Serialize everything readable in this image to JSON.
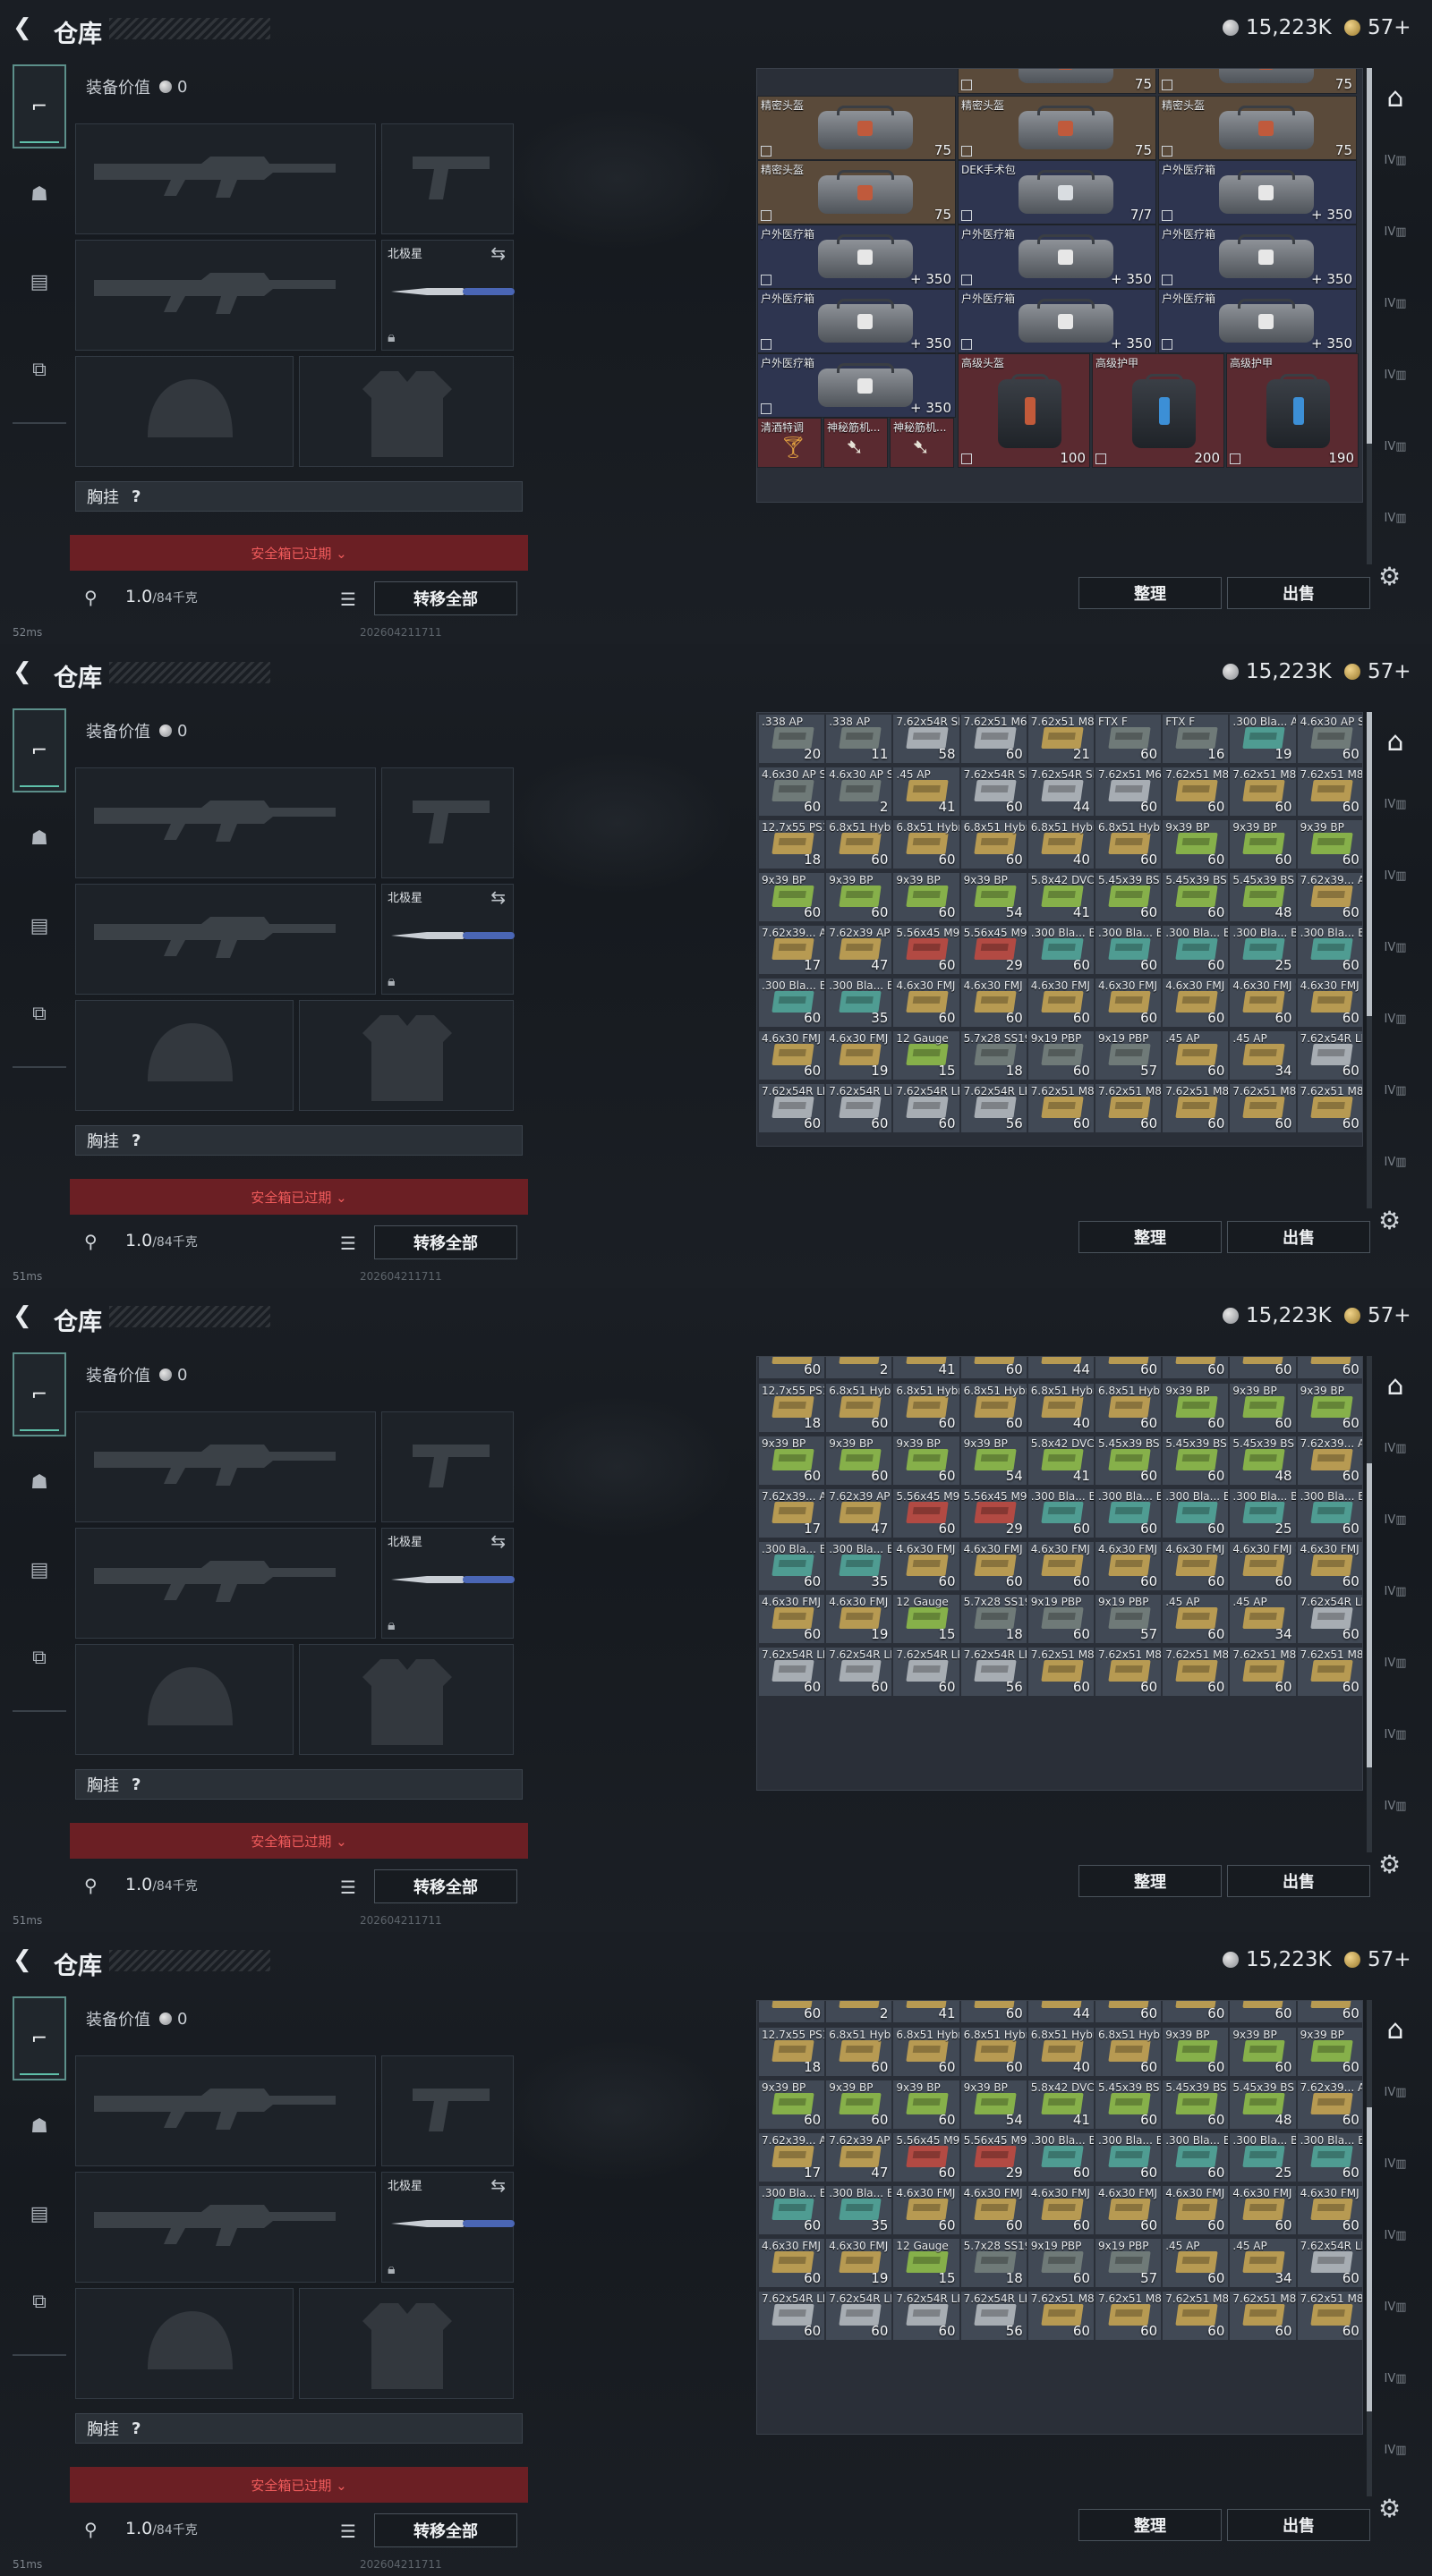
{
  "header": {
    "title": "仓库",
    "currency_value": "15,223K",
    "points_value": "57+"
  },
  "equipment": {
    "value_label": "装备价值",
    "value": "0",
    "knife_name": "北极星",
    "chest_label": "胸挂",
    "chest_hint": "?",
    "secure_box": "安全箱已过期 ⌄",
    "weight_value": "1.0",
    "weight_max": "/84千克",
    "transfer_all": "转移全部"
  },
  "actions": {
    "sort": "整理",
    "sell": "出售"
  },
  "status": [
    {
      "ping": "52ms",
      "build": "202604211711"
    },
    {
      "ping": "51ms",
      "build": "202604211711"
    },
    {
      "ping": "51ms",
      "build": "202604211711"
    },
    {
      "ping": "51ms",
      "build": "202604211711"
    }
  ],
  "inventory_page1": {
    "gear_row0": [
      {
        "quantity": "75"
      },
      {
        "quantity": "75"
      }
    ],
    "gear": [
      {
        "name": "精密头盔",
        "quantity": "75"
      },
      {
        "name": "精密头盔",
        "quantity": "75"
      },
      {
        "name": "精密头盔",
        "quantity": "75"
      },
      {
        "name": "精密头盔",
        "quantity": "75"
      },
      {
        "name": "DEK手术包",
        "quantity": "7/7"
      },
      {
        "name": "户外医疗箱",
        "quantity": "+ 350"
      },
      {
        "name": "户外医疗箱",
        "quantity": "+ 350"
      },
      {
        "name": "户外医疗箱",
        "quantity": "+ 350"
      },
      {
        "name": "户外医疗箱",
        "quantity": "+ 350"
      },
      {
        "name": "户外医疗箱",
        "quantity": "+ 350"
      },
      {
        "name": "户外医疗箱",
        "quantity": "+ 350"
      },
      {
        "name": "户外医疗箱",
        "quantity": "+ 350"
      },
      {
        "name": "户外医疗箱",
        "quantity": "+ 350"
      },
      {
        "name": "高级头盔",
        "quantity": "100"
      },
      {
        "name": "高级护甲",
        "quantity": "200"
      },
      {
        "name": "高级护甲",
        "quantity": "190"
      }
    ],
    "small": [
      {
        "name": "清酒特调"
      },
      {
        "name": "神秘筋机..."
      },
      {
        "name": "神秘筋机..."
      }
    ]
  },
  "ammo_rows_full": [
    [
      {
        "n": ".338 AP",
        "q": "20"
      },
      {
        "n": ".338 AP",
        "q": "11"
      },
      {
        "n": "7.62x54R SNB",
        "q": "58"
      },
      {
        "n": "7.62x51 M62",
        "q": "60"
      },
      {
        "n": "7.62x51 M80",
        "q": "21"
      },
      {
        "n": "FTX F",
        "q": "60"
      },
      {
        "n": "FTX F",
        "q": "16"
      },
      {
        "n": ".300 Bla... AP",
        "q": "19"
      },
      {
        "n": "4.6x30 AP SX",
        "q": "60"
      }
    ],
    [
      {
        "n": "4.6x30 AP SX",
        "q": "60"
      },
      {
        "n": "4.6x30 AP SX",
        "q": "2"
      },
      {
        "n": ".45 AP",
        "q": "41"
      },
      {
        "n": "7.62x54R SNB",
        "q": "60"
      },
      {
        "n": "7.62x54R SNB",
        "q": "44"
      },
      {
        "n": "7.62x51 M62",
        "q": "60"
      },
      {
        "n": "7.62x51 M80",
        "q": "60"
      },
      {
        "n": "7.62x51 M80",
        "q": "60"
      },
      {
        "n": "7.62x51 M80",
        "q": "60"
      }
    ],
    [
      {
        "n": "12.7x55 PS12B",
        "q": "18"
      },
      {
        "n": "6.8x51 Hybrid",
        "q": "60"
      },
      {
        "n": "6.8x51 Hybrid",
        "q": "60"
      },
      {
        "n": "6.8x51 Hybrid",
        "q": "60"
      },
      {
        "n": "6.8x51 Hybrid",
        "q": "40"
      },
      {
        "n": "6.8x51 Hybrid",
        "q": "60"
      },
      {
        "n": "9x39 BP",
        "q": "60"
      },
      {
        "n": "9x39 BP",
        "q": "60"
      },
      {
        "n": "9x39 BP",
        "q": "60"
      }
    ],
    [
      {
        "n": "9x39 BP",
        "q": "60"
      },
      {
        "n": "9x39 BP",
        "q": "60"
      },
      {
        "n": "9x39 BP",
        "q": "60"
      },
      {
        "n": "9x39 BP",
        "q": "54"
      },
      {
        "n": "5.8x42 DVC12",
        "q": "41"
      },
      {
        "n": "5.45x39 BS",
        "q": "60"
      },
      {
        "n": "5.45x39 BS",
        "q": "60"
      },
      {
        "n": "5.45x39 BS",
        "q": "48"
      },
      {
        "n": "7.62x39... AP",
        "q": "60"
      }
    ],
    [
      {
        "n": "7.62x39... AP",
        "q": "17"
      },
      {
        "n": "7.62x39 AP",
        "q": "47"
      },
      {
        "n": "5.56x45 M995",
        "q": "60"
      },
      {
        "n": "5.56x45 M995",
        "q": "29"
      },
      {
        "n": ".300 Bla... BPZ",
        "q": "60"
      },
      {
        "n": ".300 Bla... BPZ",
        "q": "60"
      },
      {
        "n": ".300 Bla... BPZ",
        "q": "60"
      },
      {
        "n": ".300 Bla... BPZ",
        "q": "25"
      },
      {
        "n": ".300 Bla... BPZ",
        "q": "60"
      }
    ],
    [
      {
        "n": ".300 Bla... BPZ",
        "q": "60"
      },
      {
        "n": ".300 Bla... BPZ",
        "q": "35"
      },
      {
        "n": "4.6x30 FMJ SX",
        "q": "60"
      },
      {
        "n": "4.6x30 FMJ SX",
        "q": "60"
      },
      {
        "n": "4.6x30 FMJ SX",
        "q": "60"
      },
      {
        "n": "4.6x30 FMJ SX",
        "q": "60"
      },
      {
        "n": "4.6x30 FMJ SX",
        "q": "60"
      },
      {
        "n": "4.6x30 FMJ SX",
        "q": "60"
      },
      {
        "n": "4.6x30 FMJ SX",
        "q": "60"
      }
    ],
    [
      {
        "n": "4.6x30 FMJ SX",
        "q": "60"
      },
      {
        "n": "4.6x30 FMJ SX",
        "q": "19"
      },
      {
        "n": "12 Gauge",
        "q": "15"
      },
      {
        "n": "5.7x28 SS190",
        "q": "18"
      },
      {
        "n": "9x19 PBP",
        "q": "60"
      },
      {
        "n": "9x19 PBP",
        "q": "57"
      },
      {
        "n": ".45 AP",
        "q": "60"
      },
      {
        "n": ".45 AP",
        "q": "34"
      },
      {
        "n": "7.62x54R LPS",
        "q": "60"
      }
    ],
    [
      {
        "n": "7.62x54R LPS",
        "q": "60"
      },
      {
        "n": "7.62x54R LPS",
        "q": "60"
      },
      {
        "n": "7.62x54R LPS",
        "q": "60"
      },
      {
        "n": "7.62x54R LPS",
        "q": "56"
      },
      {
        "n": "7.62x51 M80",
        "q": "60"
      },
      {
        "n": "7.62x51 M80",
        "q": "60"
      },
      {
        "n": "7.62x51 M80",
        "q": "60"
      },
      {
        "n": "7.62x51 M80",
        "q": "60"
      },
      {
        "n": "7.62x51 M80",
        "q": "60"
      }
    ]
  ],
  "ammo_scrolled_top": [
    {
      "q": "60"
    },
    {
      "q": "2"
    },
    {
      "q": "41"
    },
    {
      "q": "60"
    },
    {
      "q": "44"
    },
    {
      "q": "60"
    },
    {
      "q": "60"
    },
    {
      "q": "60"
    },
    {
      "q": "60"
    }
  ],
  "colors": {
    "accent": "#5fc0aa",
    "danger": "#6b1f24",
    "tan": "#b79a52",
    "green": "#86b04a",
    "grey": "#a7adb3",
    "red": "#b24a43",
    "teal": "#4f9c92"
  }
}
